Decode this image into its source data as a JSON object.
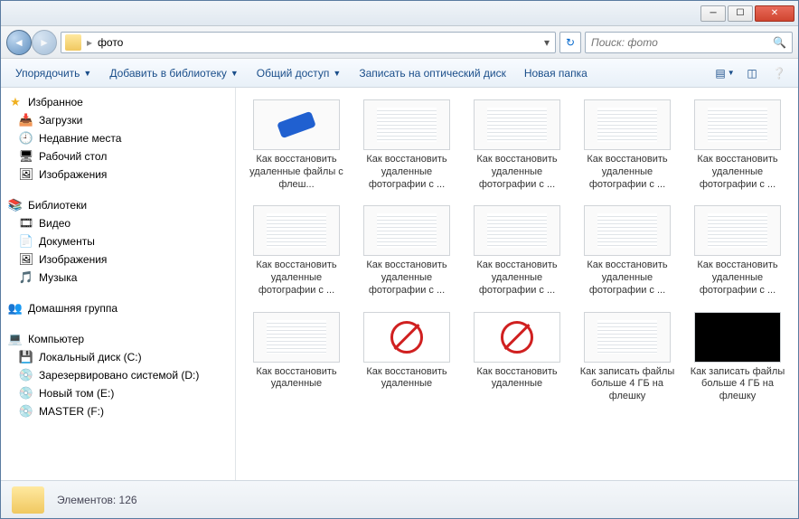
{
  "titlebar": {
    "title": "фото"
  },
  "address": {
    "path_segment": "фото"
  },
  "search": {
    "placeholder": "Поиск: фото"
  },
  "toolbar": {
    "organize": "Упорядочить",
    "add_library": "Добавить в библиотеку",
    "share": "Общий доступ",
    "burn": "Записать на оптический диск",
    "new_folder": "Новая папка"
  },
  "sidebar": {
    "favorites": {
      "label": "Избранное",
      "items": [
        {
          "label": "Загрузки"
        },
        {
          "label": "Недавние места"
        },
        {
          "label": "Рабочий стол"
        },
        {
          "label": "Изображения"
        }
      ]
    },
    "libraries": {
      "label": "Библиотеки",
      "items": [
        {
          "label": "Видео"
        },
        {
          "label": "Документы"
        },
        {
          "label": "Изображения"
        },
        {
          "label": "Музыка"
        }
      ]
    },
    "homegroup": {
      "label": "Домашняя группа"
    },
    "computer": {
      "label": "Компьютер",
      "items": [
        {
          "label": "Локальный диск (C:)"
        },
        {
          "label": "Зарезервировано системой (D:)"
        },
        {
          "label": "Новый том (E:)"
        },
        {
          "label": "MASTER (F:)"
        }
      ]
    }
  },
  "files": [
    {
      "label": "Как восстановить удаленные файлы с флеш...",
      "kind": "usb"
    },
    {
      "label": "Как восстановить удаленные фотографии с ...",
      "kind": "doc"
    },
    {
      "label": "Как восстановить удаленные фотографии с ...",
      "kind": "doc"
    },
    {
      "label": "Как восстановить удаленные фотографии с ...",
      "kind": "doc"
    },
    {
      "label": "Как восстановить удаленные фотографии с ...",
      "kind": "doc"
    },
    {
      "label": "Как восстановить удаленные фотографии с ...",
      "kind": "doc"
    },
    {
      "label": "Как восстановить удаленные фотографии с ...",
      "kind": "doc"
    },
    {
      "label": "Как восстановить удаленные фотографии с ...",
      "kind": "doc"
    },
    {
      "label": "Как восстановить удаленные фотографии с ...",
      "kind": "doc"
    },
    {
      "label": "Как восстановить удаленные фотографии с ...",
      "kind": "doc"
    },
    {
      "label": "Как восстановить удаленные",
      "kind": "doc"
    },
    {
      "label": "Как восстановить удаленные",
      "kind": "nofoto"
    },
    {
      "label": "Как восстановить удаленные",
      "kind": "nofoto"
    },
    {
      "label": "Как записать файлы больше 4 ГБ на флешку",
      "kind": "doc"
    },
    {
      "label": "Как записать файлы больше 4 ГБ на флешку",
      "kind": "cmd"
    }
  ],
  "status": {
    "count_label": "Элементов: 126"
  }
}
